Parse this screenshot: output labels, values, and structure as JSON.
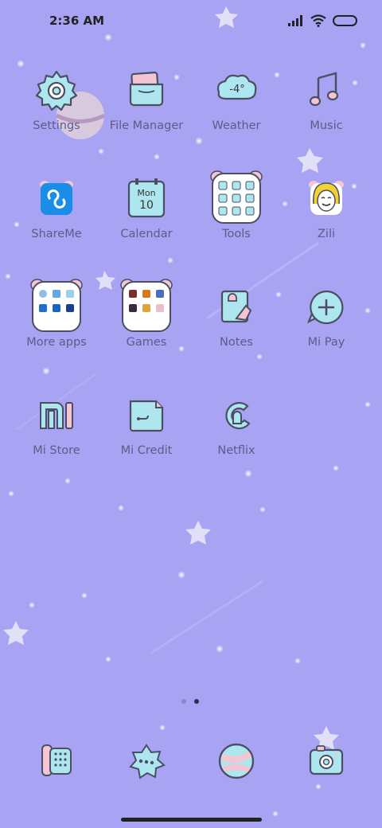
{
  "status_bar": {
    "time": "2:36 AM",
    "icons": [
      "signal-icon",
      "wifi-icon",
      "battery-icon"
    ]
  },
  "weather_widget_text": "-4°",
  "calendar_icon": {
    "day": "Mon",
    "date": "10"
  },
  "apps": [
    {
      "label": "Settings",
      "icon": "gear-icon"
    },
    {
      "label": "File Manager",
      "icon": "folder-icon"
    },
    {
      "label": "Weather",
      "icon": "cloud-icon"
    },
    {
      "label": "Music",
      "icon": "music-note-icon"
    },
    {
      "label": "ShareMe",
      "icon": "shareme-icon"
    },
    {
      "label": "Calendar",
      "icon": "calendar-icon"
    },
    {
      "label": "Tools",
      "icon": "tools-folder-icon"
    },
    {
      "label": "Zili",
      "icon": "zili-icon"
    },
    {
      "label": "More apps",
      "icon": "more-apps-folder-icon"
    },
    {
      "label": "Games",
      "icon": "games-folder-icon"
    },
    {
      "label": "Notes",
      "icon": "notes-icon"
    },
    {
      "label": "Mi Pay",
      "icon": "mi-pay-icon"
    },
    {
      "label": "Mi Store",
      "icon": "mi-store-icon"
    },
    {
      "label": "Mi Credit",
      "icon": "mi-credit-icon"
    },
    {
      "label": "Netflix",
      "icon": "netflix-icon"
    }
  ],
  "dock": [
    {
      "icon": "phone-icon"
    },
    {
      "icon": "messages-icon"
    },
    {
      "icon": "browser-icon"
    },
    {
      "icon": "camera-icon"
    }
  ],
  "page_indicator": {
    "pages": 2,
    "current": 2
  },
  "colors": {
    "background": "#a8a3f3",
    "icon_fill": "#aee6f0",
    "icon_accent": "#f4c6d3",
    "outline": "#4a4f63",
    "label": "#5f5b86"
  }
}
